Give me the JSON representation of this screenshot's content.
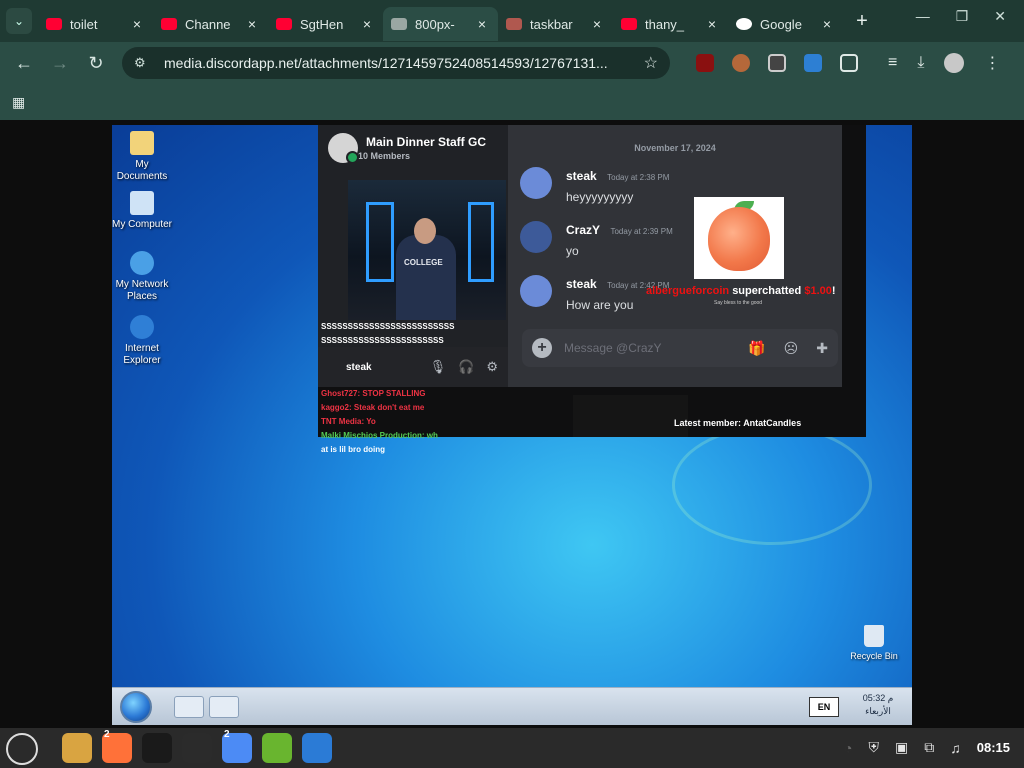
{
  "browser": {
    "tabs": [
      {
        "label": "toilet",
        "color": "#ff0033",
        "close": "×"
      },
      {
        "label": "Channe",
        "color": "#ff0033",
        "close": "×"
      },
      {
        "label": "SgtHen",
        "color": "#ff0033",
        "close": "×"
      },
      {
        "label": "800px-",
        "color": "#9aa7a3",
        "close": "×"
      },
      {
        "label": "taskbar",
        "color": "#b0584f",
        "close": "×"
      },
      {
        "label": "thany_",
        "color": "#ff0033",
        "close": "×"
      },
      {
        "label": "Google",
        "color": "#ffffff",
        "close": "×"
      }
    ],
    "new_tab": "+",
    "url": "media.discordapp.net/attachments/1271459752408514593/12767131...",
    "icons": {
      "back": "←",
      "forward": "→",
      "reload": "↻",
      "star": "☆",
      "download": "⤓",
      "menu": "⋮",
      "apps": "▦"
    }
  },
  "xp_desktop": {
    "icons": [
      {
        "label": "My Documents"
      },
      {
        "label": "My Computer"
      },
      {
        "label": "My Network Places"
      },
      {
        "label": "Internet Explorer"
      }
    ],
    "recycle_bin": "Recycle Bin",
    "taskbar": {
      "lang": "EN",
      "time": "05:32 م",
      "day": "الأربعاء"
    }
  },
  "discord": {
    "group_name": "Main Dinner Staff GC",
    "members": "10 Members",
    "date": "November 17, 2024",
    "messages": [
      {
        "author": "steak",
        "time": "Today at 2:38 PM",
        "text": "heyyyyyyyyy",
        "color": "#6b8bd8"
      },
      {
        "author": "CrazY",
        "time": "Today at 2:39 PM",
        "text": "yo",
        "color": "#3d5a99"
      },
      {
        "author": "steak",
        "time": "Today at 2:42 PM",
        "text": "How are you",
        "color": "#6b8bd8"
      }
    ],
    "composer_placeholder": "Message @CrazY",
    "voice_user": "steak",
    "superchat_user": "albergueforcoin",
    "superchat_text": "superchatted",
    "superchat_amount": "$1.00",
    "superchat_sub": "Say bless to the good",
    "latest_member": "Latest member: AntatCandles"
  },
  "stream_chat": [
    "SSSSSSSSSSSSSSSSSSSSSSSSS",
    "SSSSSSSSSSSSSSSSSSSSSSS",
    "Ghost727: STOP STALLING",
    "kaggo2: Steak don't eat me",
    "TNT Media: Yo",
    "Malki Mischios Production: wh",
    "at is lil bro doing"
  ],
  "panel": {
    "apps": [
      {
        "name": "files",
        "color": "#d9a441"
      },
      {
        "name": "firefox",
        "color": "#ff7139",
        "badge": "2"
      },
      {
        "name": "terminal",
        "color": "#1a1a1a"
      },
      {
        "name": "obs",
        "color": "#2b2b2b"
      },
      {
        "name": "chrome",
        "color": "#4c8bf5",
        "badge": "2"
      },
      {
        "name": "calculator",
        "color": "#69b52f"
      },
      {
        "name": "text-editor",
        "color": "#2b7bd6"
      }
    ],
    "clock": "08:15"
  }
}
